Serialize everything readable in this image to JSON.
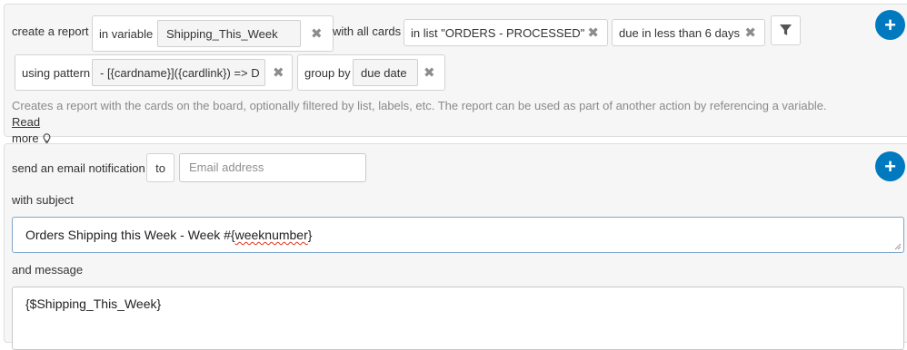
{
  "report": {
    "create_label": "create a report",
    "variable_prefix": "in variable",
    "variable_value": "Shipping_This_Week",
    "cards_label": "with all cards",
    "list_filter": "in list \"ORDERS - PROCESSED\"",
    "due_filter": "due in less than 6 days",
    "pattern_prefix": "using pattern",
    "pattern_value": "- [{cardname}]({cardlink}) => D",
    "group_prefix": "group by",
    "group_value": "due date",
    "description": "Creates a report with the cards on the board, optionally filtered by list, labels, etc. The report can be used as part of another action by referencing a variable.",
    "read_more_1": "Read",
    "read_more_2": "more",
    "icons": {
      "remove": "close-icon",
      "filter": "filter-icon",
      "add": "plus-icon",
      "hint": "lightbulb-icon"
    }
  },
  "email": {
    "send_label": "send an email notification",
    "to_label": "to",
    "email_placeholder": "Email address",
    "subject_label": "with subject",
    "subject_value_prefix": "Orders Shipping this Week - Week #{",
    "subject_value_word": "weeknumber",
    "subject_value_suffix": "}",
    "message_label": "and message",
    "message_value": "{$Shipping_This_Week}"
  },
  "colors": {
    "accent": "#0079bf",
    "panel_bg": "#f6f6f6",
    "spellcheck": "#e0341b"
  }
}
